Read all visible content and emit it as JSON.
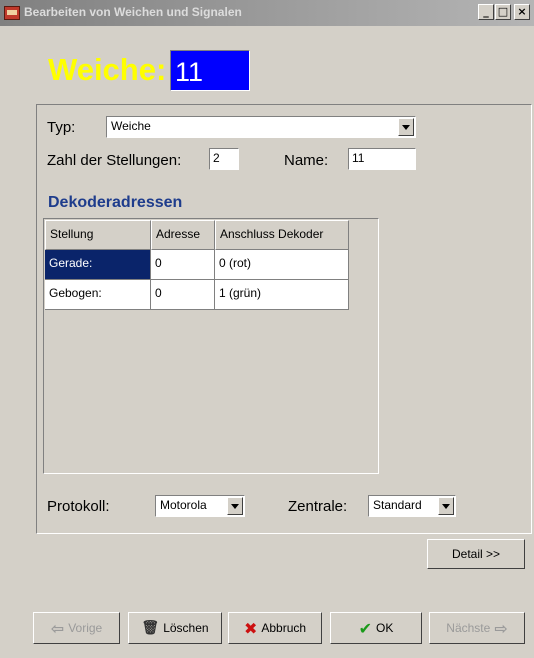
{
  "window": {
    "title": "Bearbeiten von Weichen und Signalen",
    "minimize_glyph": "_",
    "maximize_glyph": "□",
    "close_glyph": "×"
  },
  "header": {
    "label": "Weiche:",
    "value": "11"
  },
  "form": {
    "typ_label": "Typ:",
    "typ_value": "Weiche",
    "stellungen_label": "Zahl der Stellungen:",
    "stellungen_value": "2",
    "name_label": "Name:",
    "name_value": "11"
  },
  "dekoder": {
    "title": "Dekoderadressen",
    "columns": [
      "Stellung",
      "Adresse",
      "Anschluss Dekoder"
    ],
    "rows": [
      {
        "stellung": "Gerade:",
        "adresse": "0",
        "anschluss": "0 (rot)"
      },
      {
        "stellung": "Gebogen:",
        "adresse": "0",
        "anschluss": "1 (grün)"
      }
    ]
  },
  "protokoll": {
    "label": "Protokoll:",
    "value": "Motorola"
  },
  "zentrale": {
    "label": "Zentrale:",
    "value": "Standard"
  },
  "buttons": {
    "detail": "Detail >>",
    "vorige": "Vorige",
    "loeschen": "Löschen",
    "abbruch": "Abbruch",
    "ok": "OK",
    "naechste": "Nächste"
  },
  "icons": {
    "vorige": "⇦",
    "loeschen": "🗑",
    "abbruch": "✖",
    "ok": "✔",
    "naechste": "⇨"
  },
  "colors": {
    "header_label": "#ffff00",
    "header_value_bg": "#0000ff",
    "selection": "#0a246a",
    "section_title": "#1e3c8c"
  }
}
